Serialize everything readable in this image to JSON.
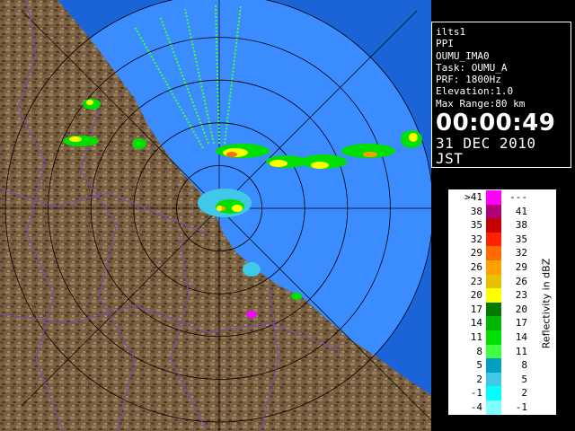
{
  "info_panel": {
    "lines": [
      "ilts1",
      "PPI",
      "OUMU_IMA0",
      "Task: OUMU_A",
      "PRF: 1800Hz",
      "Elevation:1.0",
      "Max Range:80 km"
    ],
    "time": "00:00:49",
    "date": "31 DEC 2010 JST"
  },
  "legend": {
    "title": "Reflectivity in dBZ",
    "rows": [
      {
        "low": ">41",
        "high": "---",
        "color": "#ff00ff"
      },
      {
        "low": "38",
        "high": "41",
        "color": "#b0007a"
      },
      {
        "low": "35",
        "high": "38",
        "color": "#c80000"
      },
      {
        "low": "32",
        "high": "35",
        "color": "#ff2200"
      },
      {
        "low": "29",
        "high": "32",
        "color": "#ff6a00"
      },
      {
        "low": "26",
        "high": "29",
        "color": "#ffa000"
      },
      {
        "low": "23",
        "high": "26",
        "color": "#e8c000"
      },
      {
        "low": "20",
        "high": "23",
        "color": "#ffff00"
      },
      {
        "low": "17",
        "high": "20",
        "color": "#007a00"
      },
      {
        "low": "14",
        "high": "17",
        "color": "#00b400"
      },
      {
        "low": "11",
        "high": "14",
        "color": "#00e000"
      },
      {
        "low": "8",
        "high": "11",
        "color": "#40ff40"
      },
      {
        "low": "5",
        "high": "8",
        "color": "#00a0c0"
      },
      {
        "low": "2",
        "high": "5",
        "color": "#40c8e8"
      },
      {
        "low": "-1",
        "high": "2",
        "color": "#00ffff"
      },
      {
        "low": "-4",
        "high": "-1",
        "color": "#80ffff"
      }
    ]
  },
  "colors": {
    "ocean": "#1a64d8",
    "radar_disc": "#3a8cff",
    "land": "#7a5f40",
    "background": "#000000",
    "range_ring": "#000000",
    "boundary": "#7a4ab4"
  },
  "map": {
    "range_rings": 5
  }
}
